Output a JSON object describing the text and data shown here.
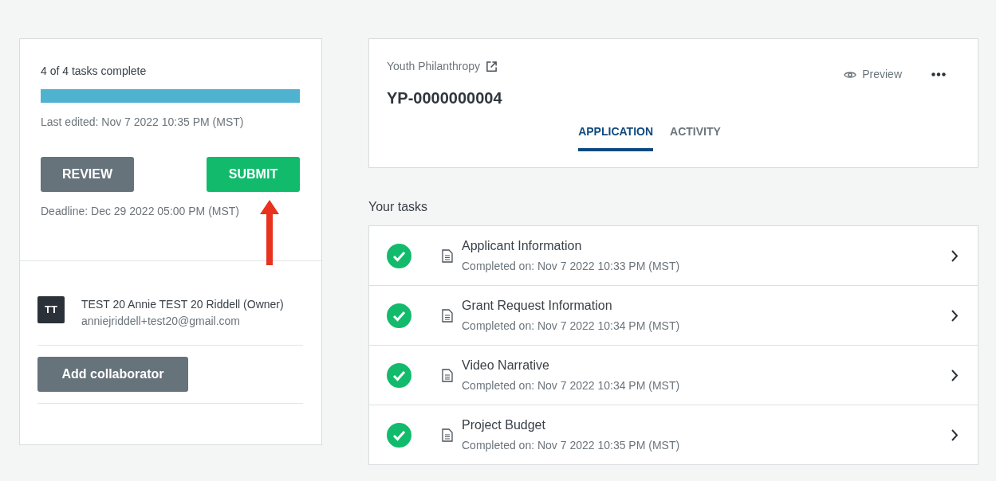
{
  "progress": {
    "label": "4 of 4 tasks complete",
    "level": 1.0,
    "last_edited": "Last edited: Nov 7 2022 10:35 PM (MST)"
  },
  "actions": [
    {
      "kind": "secondary",
      "label": "REVIEW"
    },
    {
      "kind": "primary",
      "label": "SUBMIT"
    }
  ],
  "deadline": "Deadline: Dec 29 2022 05:00 PM (MST)",
  "annotation": {
    "kind": "arrow",
    "color": "#e8321e"
  },
  "collaborators": [
    {
      "initials": "TT",
      "name": "TEST 20 Annie TEST 20 Riddell (Owner)",
      "email": "anniejriddell+test20@gmail.com"
    }
  ],
  "add_collaborator": "Add collaborator",
  "header": {
    "program": "Youth Philanthropy",
    "id": "YP-0000000004",
    "preview": "Preview",
    "tabs": [
      {
        "label": "APPLICATION",
        "selected": true
      },
      {
        "label": "ACTIVITY",
        "selected": false
      }
    ]
  },
  "tasks_title": "Your tasks",
  "tasks": [
    {
      "title": "Applicant Information",
      "completed_on": "Completed on: Nov 7 2022 10:33 PM (MST)",
      "completed": true
    },
    {
      "title": "Grant Request Information",
      "completed_on": "Completed on: Nov 7 2022 10:34 PM (MST)",
      "completed": true
    },
    {
      "title": "Video Narrative",
      "completed_on": "Completed on: Nov 7 2022 10:34 PM (MST)",
      "completed": true
    },
    {
      "title": "Project Budget",
      "completed_on": "Completed on: Nov 7 2022 10:35 PM (MST)",
      "completed": true
    }
  ]
}
